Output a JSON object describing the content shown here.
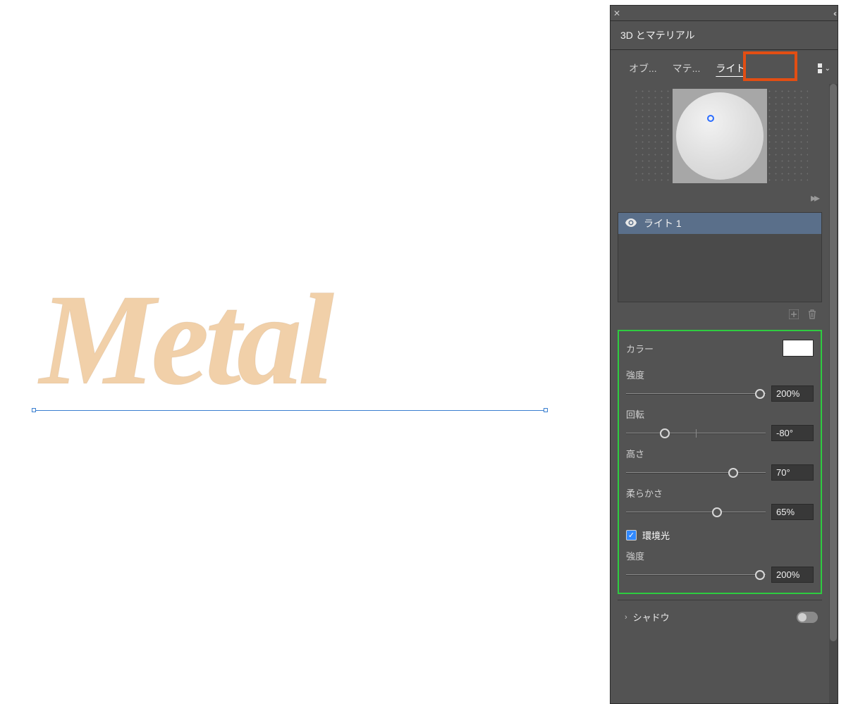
{
  "canvas": {
    "text": "Metal"
  },
  "panel": {
    "title": "3D とマテリアル",
    "tabs": {
      "objects": "オブ...",
      "materials": "マテ...",
      "lights": "ライト"
    },
    "lights_list": {
      "light1": "ライト 1"
    },
    "props": {
      "color_label": "カラー",
      "color_value": "#FFFFFF",
      "intensity_label": "強度",
      "intensity_value": "200%",
      "rotation_label": "回転",
      "rotation_value": "-80°",
      "height_label": "高さ",
      "height_value": "70°",
      "softness_label": "柔らかさ",
      "softness_value": "65%",
      "ambient_label": "環境光",
      "ambient_checked": true,
      "ambient_intensity_label": "強度",
      "ambient_intensity_value": "200%"
    },
    "shadow": {
      "label": "シャドウ",
      "enabled": false
    }
  }
}
